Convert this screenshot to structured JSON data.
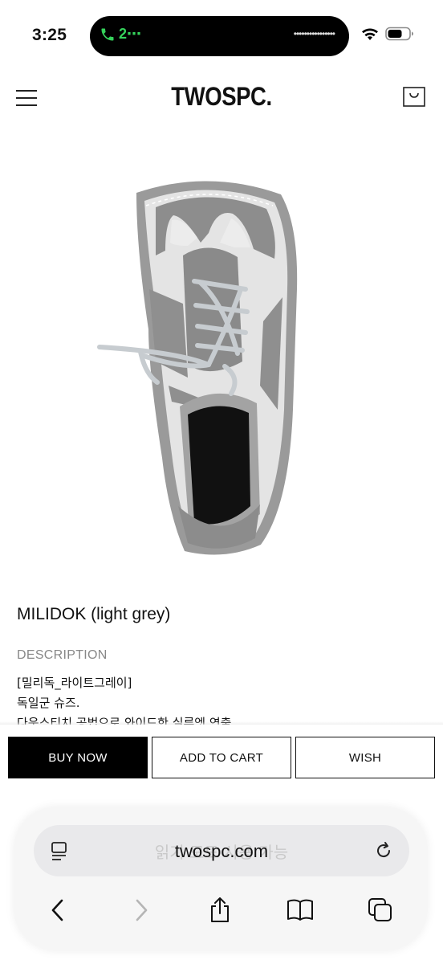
{
  "status_bar": {
    "time": "3:25",
    "call_label": "2⋯"
  },
  "header": {
    "logo": "TWOSPC."
  },
  "product": {
    "name": "MILIDOK (light grey)",
    "description_label": "DESCRIPTION",
    "description_lines": [
      "[밀리독_라이트그레이]",
      "독일군 슈즈.",
      "다운스티치 공법으로 와이드한 실루엣 연출"
    ]
  },
  "actions": {
    "buy_now": "BUY NOW",
    "add_to_cart": "ADD TO CART",
    "wish": "WISH"
  },
  "browser": {
    "url": "twospc.com",
    "ghost_text": "읽기 모드 사용 가능"
  },
  "colors": {
    "accent": "#000000",
    "call_green": "#35d25b"
  }
}
